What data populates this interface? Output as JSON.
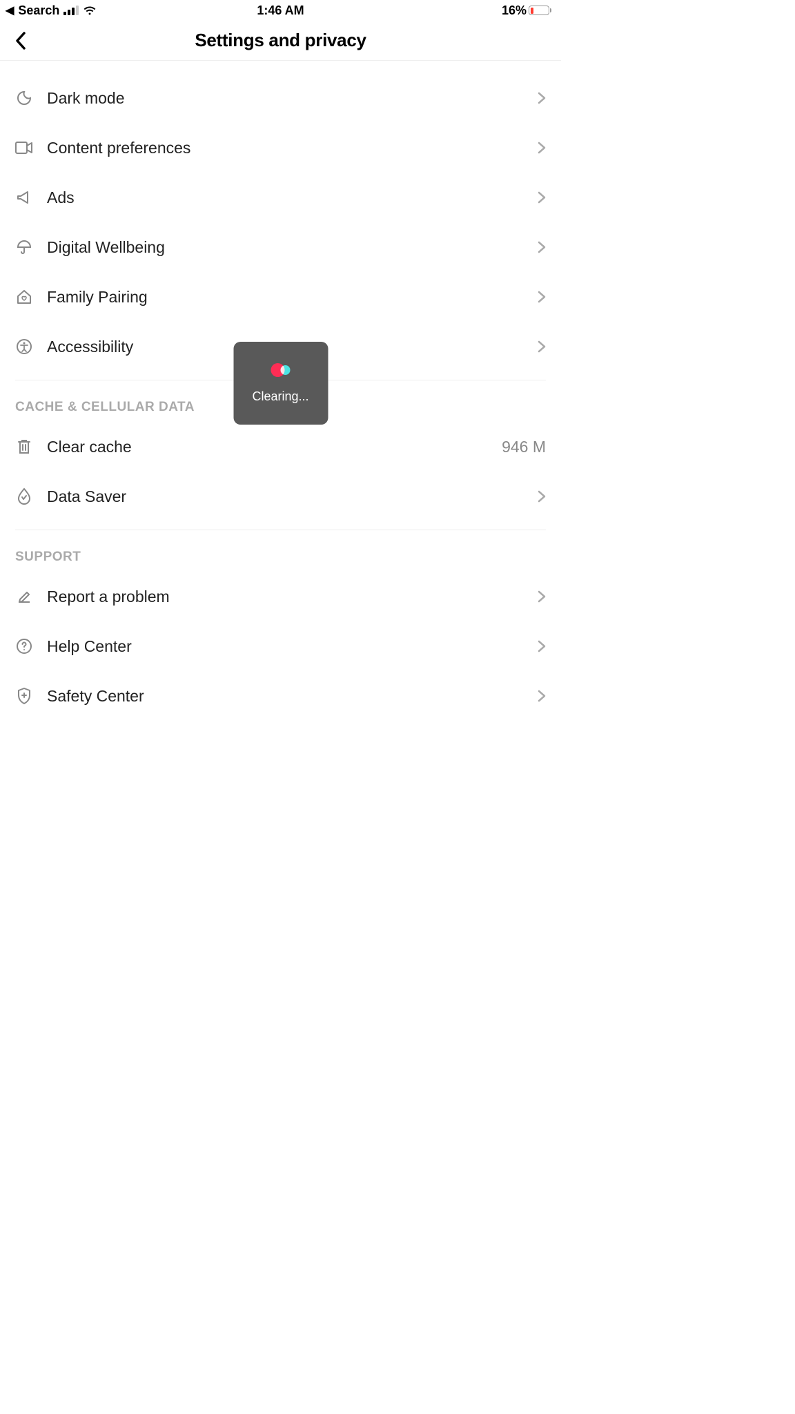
{
  "statusBar": {
    "backText": "Search",
    "time": "1:46 AM",
    "batteryPercent": "16%"
  },
  "header": {
    "title": "Settings and privacy"
  },
  "sections": {
    "main": {
      "items": [
        {
          "label": "Dark mode"
        },
        {
          "label": "Content preferences"
        },
        {
          "label": "Ads"
        },
        {
          "label": "Digital Wellbeing"
        },
        {
          "label": "Family Pairing"
        },
        {
          "label": "Accessibility"
        }
      ]
    },
    "cache": {
      "header": "CACHE & CELLULAR DATA",
      "items": [
        {
          "label": "Clear cache",
          "value": "946 M"
        },
        {
          "label": "Data Saver"
        }
      ]
    },
    "support": {
      "header": "SUPPORT",
      "items": [
        {
          "label": "Report a problem"
        },
        {
          "label": "Help Center"
        },
        {
          "label": "Safety Center"
        }
      ]
    }
  },
  "overlay": {
    "text": "Clearing..."
  }
}
